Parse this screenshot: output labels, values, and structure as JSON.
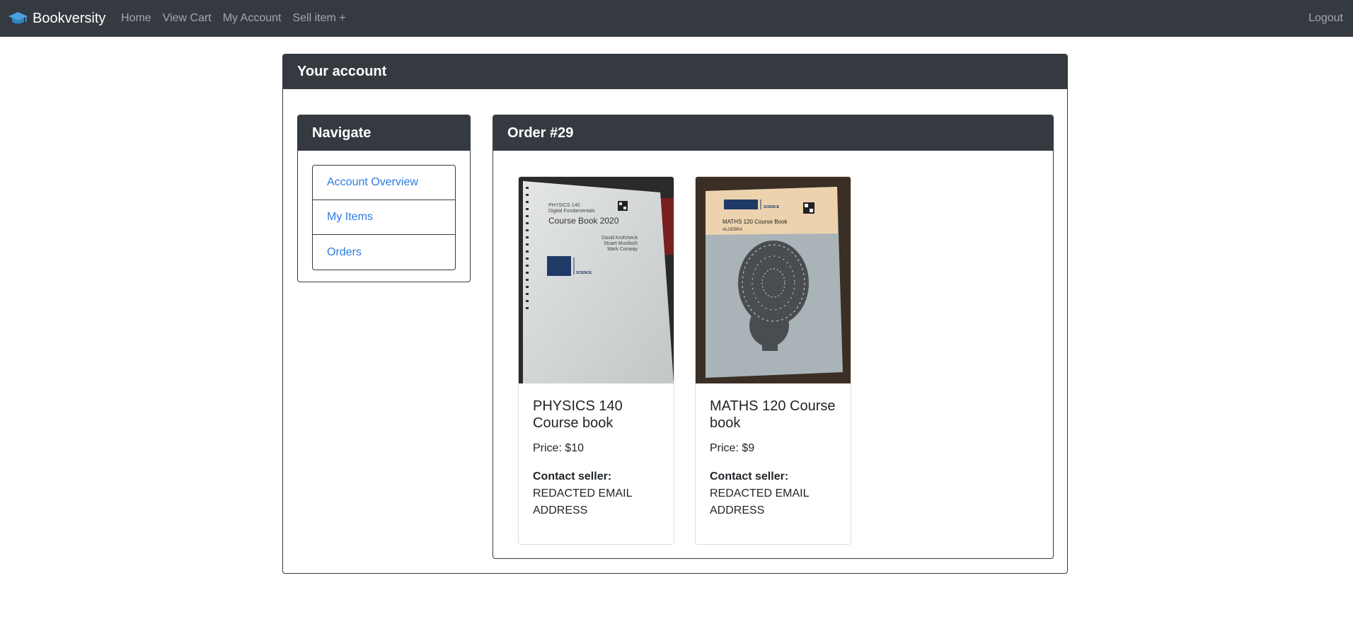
{
  "navbar": {
    "brand": "Bookversity",
    "links": [
      "Home",
      "View Cart",
      "My Account",
      "Sell item +"
    ],
    "logout": "Logout"
  },
  "account": {
    "title": "Your account"
  },
  "navigate": {
    "title": "Navigate",
    "items": [
      "Account Overview",
      "My Items",
      "Orders"
    ]
  },
  "order": {
    "title": "Order #29",
    "books": [
      {
        "title": "PHYSICS 140 Course book",
        "price": "Price: $10",
        "contact_label": "Contact seller:",
        "contact_value": "REDACTED EMAIL ADDRESS",
        "cover": {
          "line1": "PHYSICS 140",
          "line2": "Digital Fundamentals",
          "heading": "Course Book 2020",
          "authors": [
            "David Krofcheck",
            "Stuart Murdoch",
            "Mark Conway"
          ],
          "faculty": "SCIENCE"
        }
      },
      {
        "title": "MATHS 120 Course book",
        "price": "Price: $9",
        "contact_label": "Contact seller:",
        "contact_value": "REDACTED EMAIL ADDRESS",
        "cover": {
          "heading": "MATHS 120 Course Book",
          "subheading": "ALGEBRA",
          "faculty": "SCIENCE"
        }
      }
    ]
  }
}
